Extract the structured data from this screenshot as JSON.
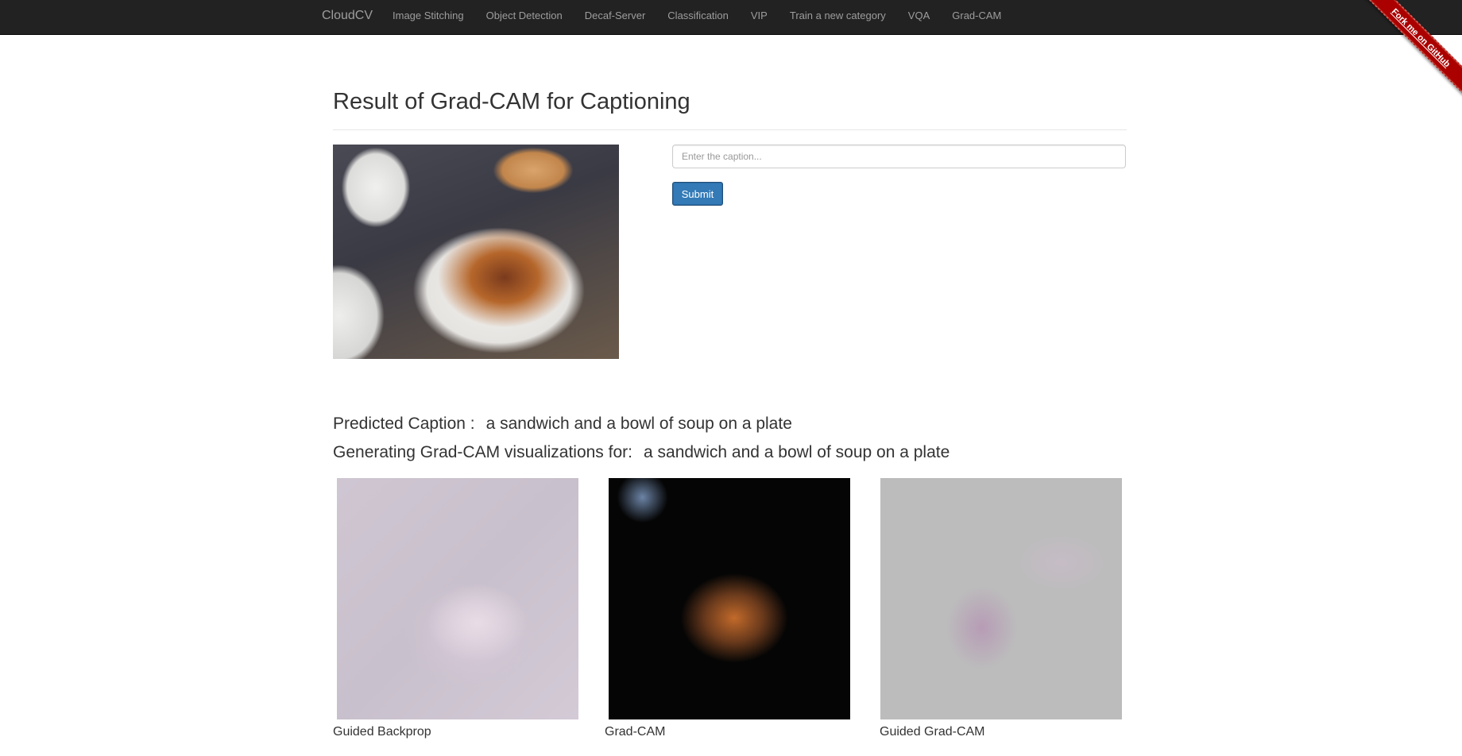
{
  "navbar": {
    "brand": "CloudCV",
    "items": [
      {
        "label": "Image Stitching"
      },
      {
        "label": "Object Detection"
      },
      {
        "label": "Decaf-Server"
      },
      {
        "label": "Classification"
      },
      {
        "label": "VIP"
      },
      {
        "label": "Train a new category"
      },
      {
        "label": "VQA"
      },
      {
        "label": "Grad-CAM"
      }
    ],
    "ribbon": "Fork me on GitHub"
  },
  "page": {
    "title": "Result of Grad-CAM for Captioning"
  },
  "form": {
    "caption_placeholder": "Enter the caption...",
    "caption_value": "",
    "submit_label": "Submit"
  },
  "results": {
    "predicted_label": "Predicted Caption :",
    "predicted_caption": "a sandwich and a bowl of soup on a plate",
    "generating_label": "Generating Grad-CAM visualizations for:",
    "generating_caption": "a sandwich and a bowl of soup on a plate",
    "images": [
      {
        "label": "Guided Backprop"
      },
      {
        "label": "Grad-CAM"
      },
      {
        "label": "Guided Grad-CAM"
      }
    ]
  },
  "colors": {
    "navbar_bg": "#222222",
    "nav_text": "#9d9d9d",
    "ribbon": "#aa0000",
    "submit_bg": "#337ab7"
  }
}
